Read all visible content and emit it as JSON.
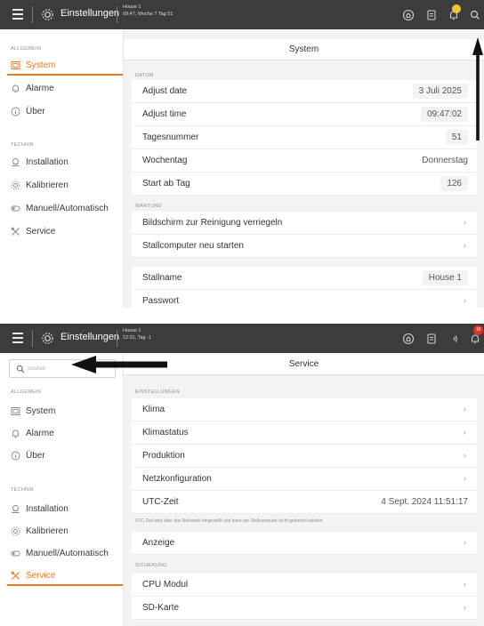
{
  "panel1": {
    "topbar": {
      "app_title": "Einstellungen",
      "house_line1": "House 1",
      "house_line2": "09:47, Woche 7 Tag 51",
      "icons": [
        "menu-icon",
        "gear-icon",
        "home-icon",
        "clipboard-icon",
        "bell-icon",
        "search-icon"
      ],
      "bell_dot_color": "#f4c430"
    },
    "sidebar": {
      "section_general": "ALLGEMEIN",
      "items_general": [
        {
          "label": "System",
          "icon": "system-icon",
          "active": true
        },
        {
          "label": "Alarme",
          "icon": "bell-icon",
          "active": false
        },
        {
          "label": "Über",
          "icon": "info-icon",
          "active": false
        }
      ],
      "section_technik": "TECHNIK",
      "items_technik": [
        {
          "label": "Installation",
          "icon": "installation-icon"
        },
        {
          "label": "Kalibrieren",
          "icon": "calibrate-icon"
        },
        {
          "label": "Manuell/Automatisch",
          "icon": "toggle-icon"
        },
        {
          "label": "Service",
          "icon": "tools-icon"
        }
      ]
    },
    "content": {
      "title": "System",
      "section_datum": "DATUM",
      "datum_rows": [
        {
          "label": "Adjust date",
          "value": "3 Juli 2025"
        },
        {
          "label": "Adjust time",
          "value": "09:47:02"
        },
        {
          "label": "Tagesnummer",
          "value": "51"
        },
        {
          "label": "Wochentag",
          "value": "Donnerstag"
        },
        {
          "label": "Start ab Tag",
          "value": "126"
        }
      ],
      "section_wartung": "WARTUNG",
      "wartung_rows": [
        {
          "label": "Bildschirm zur Reinigung verriegeln"
        },
        {
          "label": "Stallcomputer neu starten"
        }
      ],
      "stall_rows": [
        {
          "label": "Stallname",
          "value": "House 1"
        },
        {
          "label": "Passwort"
        }
      ]
    }
  },
  "panel2": {
    "topbar": {
      "app_title": "Einstellungen",
      "house_line1": "House 1",
      "house_line2": "12:31, Tag -1",
      "icons": [
        "menu-icon",
        "gear-icon",
        "home-icon",
        "clipboard-icon",
        "sound-icon",
        "bell-icon"
      ],
      "bell_badge": "10",
      "bell_badge_color": "#e4322b"
    },
    "search": {
      "placeholder": "Suchen",
      "value": ""
    },
    "sidebar": {
      "section_general": "ALLGEMEIN",
      "items_general": [
        {
          "label": "System",
          "icon": "system-icon"
        },
        {
          "label": "Alarme",
          "icon": "bell-icon"
        },
        {
          "label": "Über",
          "icon": "info-icon"
        }
      ],
      "section_technik": "TECHNIK",
      "items_technik": [
        {
          "label": "Installation",
          "icon": "installation-icon"
        },
        {
          "label": "Kalibrieren",
          "icon": "calibrate-icon"
        },
        {
          "label": "Manuell/Automatisch",
          "icon": "toggle-icon"
        },
        {
          "label": "Service",
          "icon": "tools-icon",
          "active": true
        }
      ]
    },
    "content": {
      "title": "Service",
      "section_einstellungen": "EINSTELLUNGEN",
      "einstellungen_rows": [
        {
          "label": "Klima"
        },
        {
          "label": "Klimastatus"
        },
        {
          "label": "Produktion"
        },
        {
          "label": "Netzkonfiguration"
        },
        {
          "label": "UTC-Zeit",
          "value": "4 Sept. 2024 11:51:17"
        }
      ],
      "utc_note": "UTC Zeit wird über das Netzwerk eingestellt und kann am Stallcomputer nicht geändert werden",
      "anzeige_row": {
        "label": "Anzeige"
      },
      "section_sicherung": "SICHERUNG",
      "sicherung_rows": [
        {
          "label": "CPU Modul"
        },
        {
          "label": "SD-Karte"
        }
      ]
    }
  },
  "accent_color": "#e87a1a",
  "topbar_color": "#3c3c3c"
}
